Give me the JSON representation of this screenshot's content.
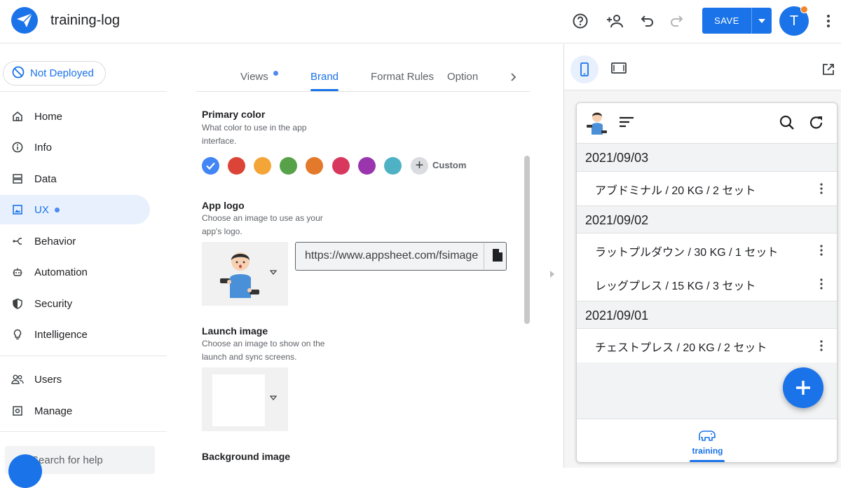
{
  "header": {
    "app_title": "training-log",
    "save_label": "SAVE",
    "avatar_initial": "T"
  },
  "sidebar": {
    "deploy_status": "Not Deployed",
    "items": [
      {
        "label": "Home",
        "icon": "home-icon"
      },
      {
        "label": "Info",
        "icon": "info-icon"
      },
      {
        "label": "Data",
        "icon": "data-icon"
      },
      {
        "label": "UX",
        "icon": "ux-icon",
        "active": true
      },
      {
        "label": "Behavior",
        "icon": "behavior-icon"
      },
      {
        "label": "Automation",
        "icon": "automation-icon"
      },
      {
        "label": "Security",
        "icon": "shield-icon"
      },
      {
        "label": "Intelligence",
        "icon": "lightbulb-icon"
      },
      {
        "label": "Users",
        "icon": "users-icon"
      },
      {
        "label": "Manage",
        "icon": "manage-icon"
      }
    ],
    "search_placeholder": "Search for help"
  },
  "tabs": [
    "Views",
    "Brand",
    "Format Rules",
    "Option"
  ],
  "brand": {
    "primary_color": {
      "title": "Primary color",
      "description": "What color to use in the app interface.",
      "swatches": [
        "#4285f4",
        "#db4437",
        "#f4a537",
        "#57a249",
        "#e2792b",
        "#d8385e",
        "#9a35ad",
        "#4eb1c4"
      ],
      "custom_label": "Custom"
    },
    "app_logo": {
      "title": "App logo",
      "description": "Choose an image to use as your app's logo.",
      "url": "https://www.appsheet.com/fsimage"
    },
    "launch_image": {
      "title": "Launch image",
      "description": "Choose an image to show on the launch and sync screens."
    },
    "background_image": {
      "title": "Background image"
    }
  },
  "preview": {
    "groups": [
      {
        "date": "2021/09/03",
        "items": [
          "アブドミナル / 20 KG / 2 セット"
        ]
      },
      {
        "date": "2021/09/02",
        "items": [
          "ラットプルダウン / 30 KG / 1 セット",
          "レッグプレス / 15 KG / 3 セット"
        ]
      },
      {
        "date": "2021/09/01",
        "items": [
          "チェストプレス / 20 KG / 2 セット"
        ]
      }
    ],
    "bottom_nav_label": "training"
  },
  "colors": {
    "accent": "#1a73e8",
    "notification_dot": "#f58426"
  }
}
